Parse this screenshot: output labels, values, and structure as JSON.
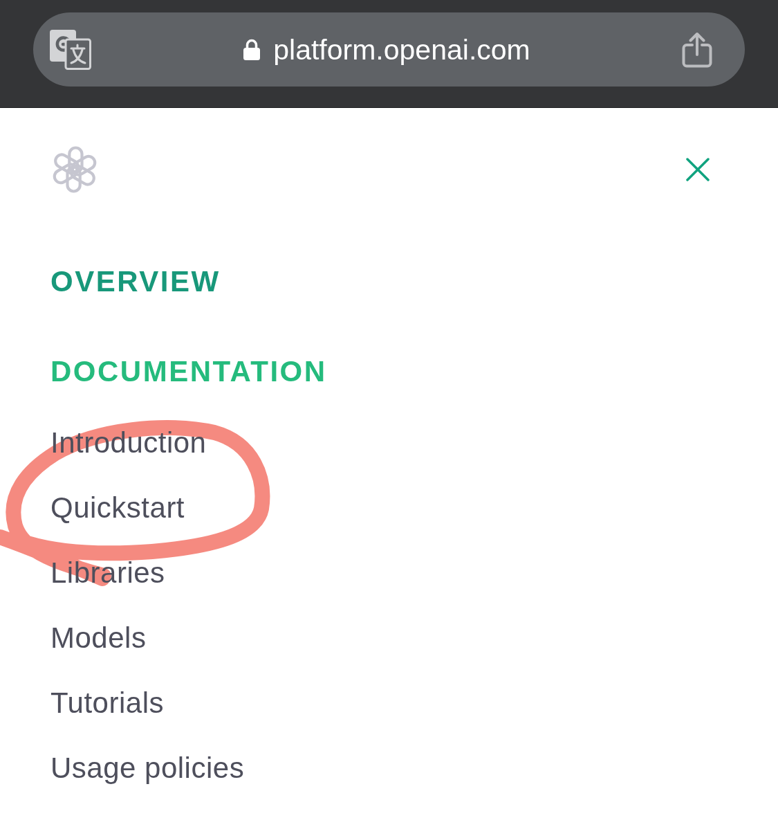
{
  "address_bar": {
    "url": "platform.openai.com",
    "secure": true
  },
  "menu": {
    "sections": [
      {
        "title": "OVERVIEW",
        "color": "#18987a"
      },
      {
        "title": "DOCUMENTATION",
        "color": "#25bb7d",
        "items": [
          "Introduction",
          "Quickstart",
          "Libraries",
          "Models",
          "Tutorials",
          "Usage policies"
        ]
      }
    ]
  }
}
